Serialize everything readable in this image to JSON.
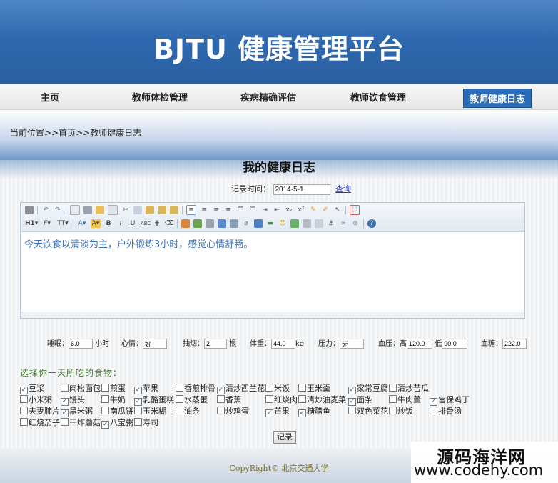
{
  "site": {
    "title": "BJTU 健康管理平台"
  },
  "nav": {
    "items": [
      "主页",
      "教师体检管理",
      "疾病精确评估",
      "教师饮食管理",
      "教师健康日志"
    ],
    "active": "教师健康日志"
  },
  "breadcrumb": "当前位置>>首页>>教师健康日志",
  "page": {
    "title": "我的健康日志"
  },
  "record": {
    "label": "记录时间：",
    "date": "2014-5-1",
    "query_label": "查询"
  },
  "editor": {
    "content": "今天饮食以清淡为主，户外锻炼3小时，感觉心情舒畅。"
  },
  "metrics": {
    "sleep_label": "睡眠：",
    "sleep_value": "6.0",
    "sleep_unit": "小时",
    "mood_label": "心情：",
    "mood_value": "好",
    "smoke_label": "抽烟：",
    "smoke_value": "2",
    "smoke_unit": "根",
    "weight_label": "体重：",
    "weight_value": "44.0",
    "weight_unit": "kg",
    "pressure_label": "压力：",
    "pressure_value": "无",
    "bp_label": "血压：",
    "bp_high_label": "高",
    "bp_high_value": "120.0",
    "bp_low_label": "低",
    "bp_low_value": "90.0",
    "sugar_label": "血糖：",
    "sugar_value": "222.0"
  },
  "foods": {
    "title": "选择你一天所吃的食物：",
    "rows": [
      [
        {
          "name": "豆浆",
          "checked": true
        },
        {
          "name": "肉松面包",
          "checked": false
        },
        {
          "name": "煎蛋",
          "checked": false
        },
        {
          "name": "苹果",
          "checked": true
        },
        {
          "name": "香煎排骨",
          "checked": false
        },
        {
          "name": "清炒西兰花",
          "checked": true
        },
        {
          "name": "米饭",
          "checked": false
        },
        {
          "name": "玉米羹",
          "checked": false
        },
        {
          "name": "家常豆腐",
          "checked": true
        },
        {
          "name": "清炒苦瓜",
          "checked": false
        }
      ],
      [
        {
          "name": "小米粥",
          "checked": false
        },
        {
          "name": "馒头",
          "checked": true
        },
        {
          "name": "牛奶",
          "checked": false
        },
        {
          "name": "乳酪蛋糕",
          "checked": true
        },
        {
          "name": "水蒸蛋",
          "checked": false
        },
        {
          "name": "香蕉",
          "checked": false
        },
        {
          "name": "红烧肉",
          "checked": false
        },
        {
          "name": "清炒油麦菜",
          "checked": false
        },
        {
          "name": "面条",
          "checked": true
        },
        {
          "name": "牛肉羹",
          "checked": false
        },
        {
          "name": "宫保鸡丁",
          "checked": true
        }
      ],
      [
        {
          "name": "夫妻肺片",
          "checked": false
        },
        {
          "name": "黑米粥",
          "checked": true
        },
        {
          "name": "南瓜饼",
          "checked": false
        },
        {
          "name": "玉米糊",
          "checked": false
        },
        {
          "name": "油条",
          "checked": false
        },
        {
          "name": "炒鸡蛋",
          "checked": false
        },
        {
          "name": "芒果",
          "checked": true
        },
        {
          "name": "糖醋鱼",
          "checked": true
        },
        {
          "name": "双色菜花",
          "checked": false
        },
        {
          "name": "炒饭",
          "checked": false
        },
        {
          "name": "排骨汤",
          "checked": false
        }
      ],
      [
        {
          "name": "红烧茄子",
          "checked": false
        },
        {
          "name": "干炸蘑菇",
          "checked": false
        },
        {
          "name": "八宝粥",
          "checked": true
        },
        {
          "name": "寿司",
          "checked": false
        }
      ]
    ]
  },
  "submit": {
    "label": "记录"
  },
  "footer": {
    "copyright": "CopyRight© 北京交通大学"
  },
  "watermark": {
    "line1": "源码海洋网",
    "line2": "www.codehy.com"
  }
}
